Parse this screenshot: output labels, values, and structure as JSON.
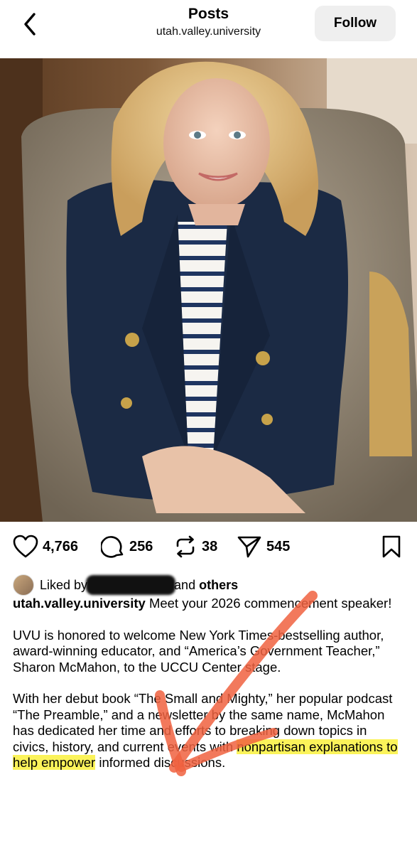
{
  "header": {
    "title": "Posts",
    "subtitle": "utah.valley.university",
    "follow_label": "Follow"
  },
  "post": {
    "likes": "4,766",
    "comments": "256",
    "reposts": "38",
    "shares": "545"
  },
  "liked_by": {
    "prefix": "Liked by",
    "middle": "and",
    "others": "others"
  },
  "caption": {
    "username": "utah.valley.university",
    "intro": "Meet your 2026 commencement speaker!",
    "para1": "UVU is honored to welcome New York Times-bestselling author, award-winning educator, and “America’s Government Teacher,” Sharon McMahon, to the UCCU Center stage.",
    "para2_a": "With her debut book “The Small and Mighty,” her popular podcast “The Preamble,” and a newsletter by the same name, McMahon has dedicated her time and efforts to breaking down topics in civics, history, and current events with ",
    "para2_highlight": "nonpartisan explanations to help empower",
    "para2_b": " informed discussions."
  },
  "colors": {
    "highlight": "#fbf35a",
    "annotation_arrow": "#f0623f",
    "blazer": "#1b2a44",
    "follow_bg": "#efefef"
  },
  "icons": [
    "back-chevron-icon",
    "heart-icon",
    "comment-icon",
    "repost-icon",
    "share-icon",
    "bookmark-icon"
  ]
}
